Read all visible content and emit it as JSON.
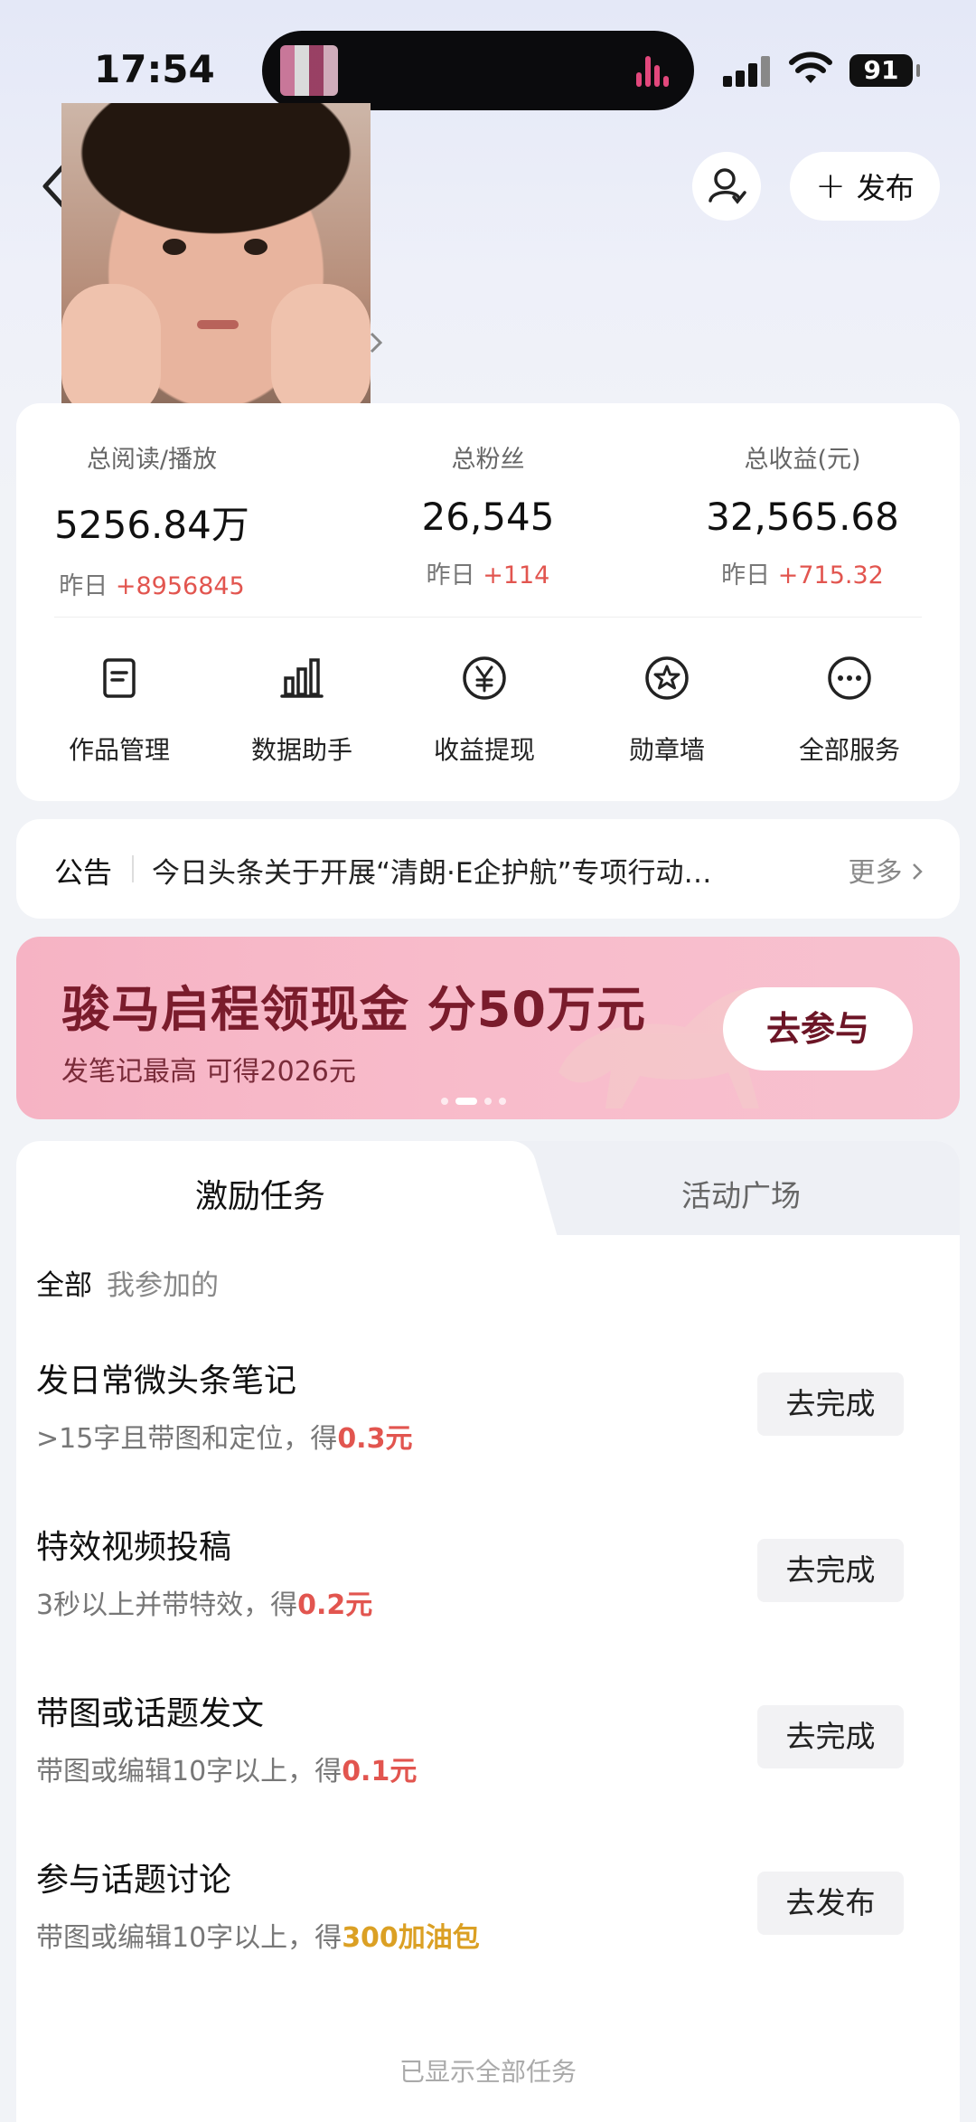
{
  "status_bar": {
    "time": "17:54",
    "battery": "91"
  },
  "header": {
    "publish_label": "发布",
    "publish_plus": "+"
  },
  "stats": [
    {
      "label": "总阅读/播放",
      "value": "5256.84万",
      "delta_prefix": "昨日",
      "delta": "+8956845"
    },
    {
      "label": "总粉丝",
      "value": "26,545",
      "delta_prefix": "昨日",
      "delta": "+114"
    },
    {
      "label": "总收益(元)",
      "value": "32,565.68",
      "delta_prefix": "昨日",
      "delta": "+715.32"
    }
  ],
  "tools": [
    {
      "label": "作品管理",
      "icon": "document-icon"
    },
    {
      "label": "数据助手",
      "icon": "bar-chart-icon"
    },
    {
      "label": "收益提现",
      "icon": "yen-icon"
    },
    {
      "label": "勋章墙",
      "icon": "medal-icon"
    },
    {
      "label": "全部服务",
      "icon": "more-icon"
    }
  ],
  "notice": {
    "tag": "公告",
    "text": "今日头条关于开展“清朗·E企护航”专项行动…",
    "more": "更多"
  },
  "banner": {
    "title": "骏马启程领现金 分50万元",
    "subtitle": "发笔记最高 可得2026元",
    "button": "去参与"
  },
  "tabs": {
    "active": "激励任务",
    "inactive": "活动广场"
  },
  "filters": {
    "all": "全部",
    "mine": "我参加的"
  },
  "tasks": [
    {
      "title": "发日常微头条笔记",
      "desc": ">15字且带图和定位，得",
      "reward": "0.3元",
      "reward_color": "#e2554f",
      "button": "去完成"
    },
    {
      "title": "特效视频投稿",
      "desc": "3秒以上并带特效，得",
      "reward": "0.2元",
      "reward_color": "#e2554f",
      "button": "去完成"
    },
    {
      "title": "带图或话题发文",
      "desc": "带图或编辑10字以上，得",
      "reward": "0.1元",
      "reward_color": "#e2554f",
      "button": "去完成"
    },
    {
      "title": "参与话题讨论",
      "desc": "带图或编辑10字以上，得",
      "reward": "300加油包",
      "reward_color": "#dba024",
      "button": "去发布"
    }
  ],
  "footer_note": "已显示全部任务",
  "colors": {
    "accent_red": "#e2554f",
    "accent_gold": "#dba024",
    "banner_pink": "#f7b8c7"
  }
}
